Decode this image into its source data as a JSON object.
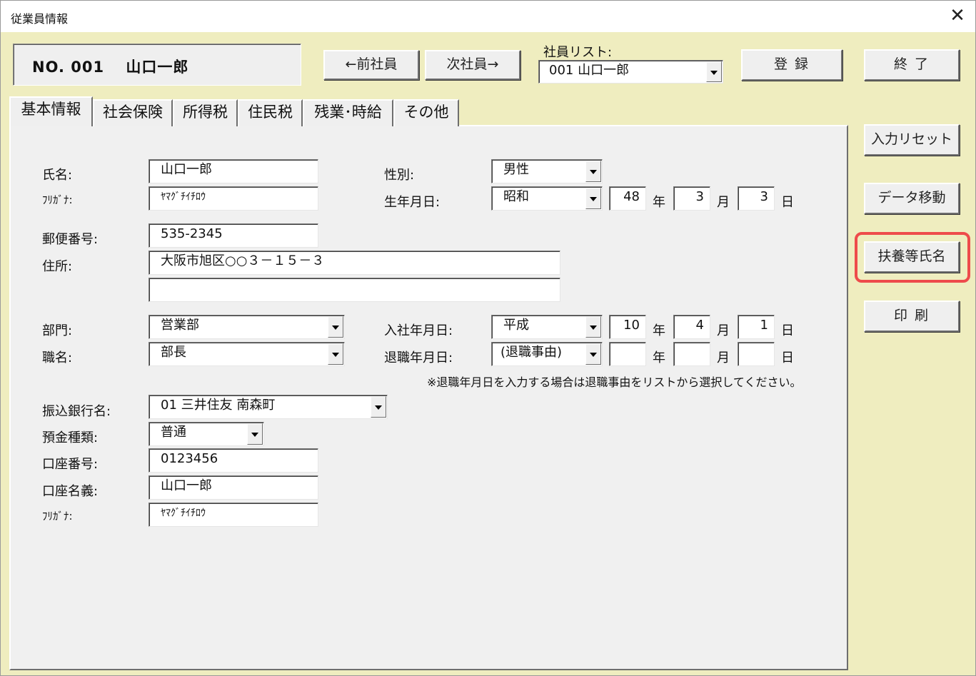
{
  "window": {
    "title": "従業員情報",
    "close": "✕"
  },
  "header": {
    "employee": "NO. 001　 山口一郎"
  },
  "nav": {
    "prev": "←前社員",
    "next": "次社員→",
    "list_label": "社員リスト:",
    "list_value": "001 山口一郎",
    "register": "登 録",
    "exit": "終 了"
  },
  "side": {
    "reset": "入力リセット",
    "data_move": "データ移動",
    "dependents": "扶養等氏名",
    "print": "印 刷"
  },
  "tabs": [
    "基本情報",
    "社会保険",
    "所得税",
    "住民税",
    "残業･時給",
    "その他"
  ],
  "form": {
    "name_label": "氏名:",
    "name_value": "山口一郎",
    "kana_label": "ﾌﾘｶﾞﾅ:",
    "kana_value": "ﾔﾏｸﾞﾁｲﾁﾛｳ",
    "gender_label": "性別:",
    "gender_value": "男性",
    "birth_label": "生年月日:",
    "birth_era": "昭和",
    "birth_year": "48",
    "birth_month": "3",
    "birth_day": "3",
    "year_unit": "年",
    "month_unit": "月",
    "day_unit": "日",
    "zip_label": "郵便番号:",
    "zip_value": "535-2345",
    "address_label": "住所:",
    "address1": "大阪市旭区○○３－１５－３",
    "address2": "",
    "dept_label": "部門:",
    "dept_value": "営業部",
    "position_label": "職名:",
    "position_value": "部長",
    "join_label": "入社年月日:",
    "join_era": "平成",
    "join_year": "10",
    "join_month": "4",
    "join_day": "1",
    "retire_label": "退職年月日:",
    "retire_reason": "(退職事由)",
    "retire_year": "",
    "retire_month": "",
    "retire_day": "",
    "retire_note": "※退職年月日を入力する場合は退職事由をリストから選択してください。",
    "bank_label": "振込銀行名:",
    "bank_value": "01 三井住友  南森町",
    "deposit_label": "預金種類:",
    "deposit_value": "普通",
    "account_no_label": "口座番号:",
    "account_no_value": "0123456",
    "account_name_label": "口座名義:",
    "account_name_value": "山口一郎",
    "account_kana_label": "ﾌﾘｶﾞﾅ:",
    "account_kana_value": "ﾔﾏｸﾞﾁｲﾁﾛｳ"
  },
  "colors": {
    "window_bg": "#efedbf",
    "panel_bg": "#f0f0f0",
    "highlight": "#ee4b4b"
  }
}
